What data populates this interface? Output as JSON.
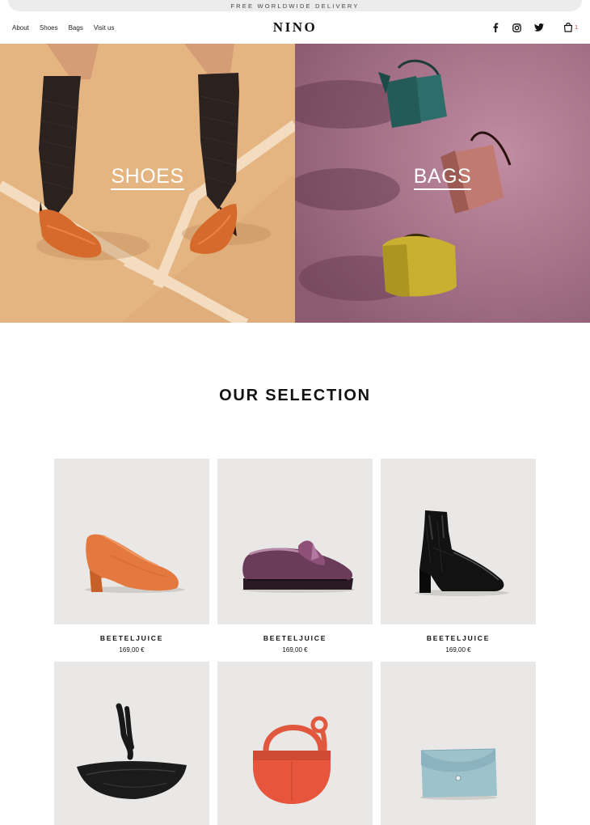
{
  "announcement": "FREE WORLDWIDE DELIVERY",
  "nav": {
    "links": [
      "About",
      "Shoes",
      "Bags",
      "Visit us"
    ],
    "logo": "NINO",
    "social_icons": [
      "facebook-icon",
      "instagram-icon",
      "twitter-icon"
    ],
    "cart_icon": "shopping-bag-icon",
    "cart_count": "1"
  },
  "hero": {
    "shoes_label": "SHOES",
    "bags_label": "BAGS"
  },
  "selection": {
    "title": "OUR SELECTION",
    "products": [
      {
        "name": "BEETELJUICE",
        "price": "169,00 €"
      },
      {
        "name": "BEETELJUICE",
        "price": "169,00 €"
      },
      {
        "name": "BEETELJUICE",
        "price": "169,00 €"
      },
      {
        "name": "",
        "price": ""
      },
      {
        "name": "",
        "price": ""
      },
      {
        "name": "",
        "price": ""
      }
    ]
  },
  "colors": {
    "accent_red": "#c0392b",
    "shoes_bg": "#e0ae7a",
    "bags_bg": "#9c6a80",
    "product_bg": "#e9e8e6"
  }
}
